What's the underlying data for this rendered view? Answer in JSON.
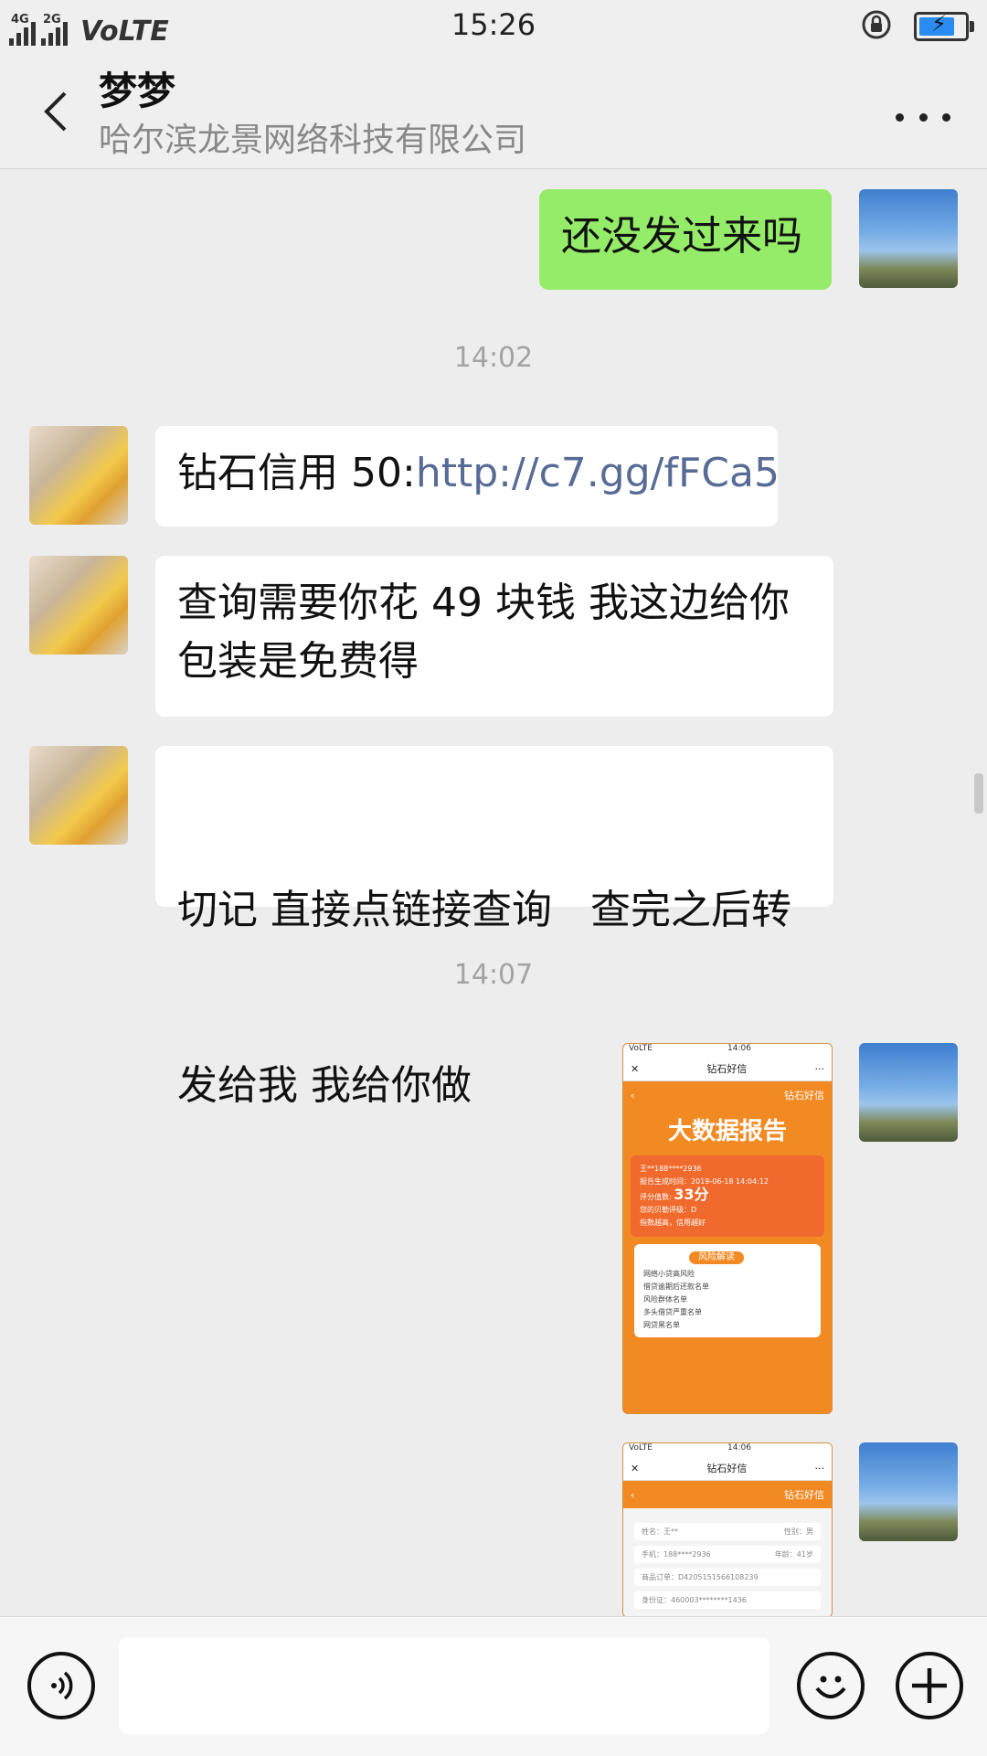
{
  "status_bar": {
    "signal_1": "4G",
    "signal_2": "2G",
    "network": "VoLTE",
    "time": "15:26"
  },
  "header": {
    "contact_name": "梦梦",
    "company": "哈尔滨龙景网络科技有限公司"
  },
  "messages": [
    {
      "side": "self",
      "type": "text",
      "text": "还没发过来吗"
    },
    {
      "type": "time",
      "text": "14:02"
    },
    {
      "side": "peer",
      "type": "text",
      "text_prefix": "钻石信用 50:",
      "link": "http://c7.gg/fFCa5"
    },
    {
      "side": "peer",
      "type": "text",
      "line1": "查询需要你花 49 块钱 我这边给你",
      "line2": "包装是免费得"
    },
    {
      "side": "peer",
      "type": "text",
      "line1": "切记 直接点链接查询   查完之后转",
      "line2": "发给我 我给你做"
    },
    {
      "type": "time",
      "text": "14:07"
    },
    {
      "side": "self",
      "type": "image",
      "screenshot": {
        "status": "VoLTE",
        "status_time": "14:06",
        "title": "钻石好信",
        "brand": "钻石好信",
        "banner": "大数据报告",
        "card_line1": "王**188****2936",
        "card_line2": "报告生成时间：2019-06-18 14:04:12",
        "score_label": "评分值数:",
        "score": "33分",
        "level": "您的贝勒评级：D",
        "index": "指数越高，信用越好",
        "pill": "风险解读",
        "risks": [
          "网络小贷高风险",
          "借贷逾期后还款名单",
          "风险群体名单",
          "多头借贷严重名单",
          "网贷黑名单"
        ]
      }
    },
    {
      "side": "self",
      "type": "image",
      "screenshot": {
        "status": "VoLTE",
        "status_time": "14:06",
        "title": "钻石好信",
        "brand": "钻石好信",
        "name": "姓名：王**",
        "gender": "性别：男",
        "phone": "手机：188****2936",
        "age": "年龄：41岁",
        "order": "商品订单：D4205151566108239",
        "id": "身份证：460003********1436"
      }
    }
  ],
  "input": {
    "value": ""
  }
}
